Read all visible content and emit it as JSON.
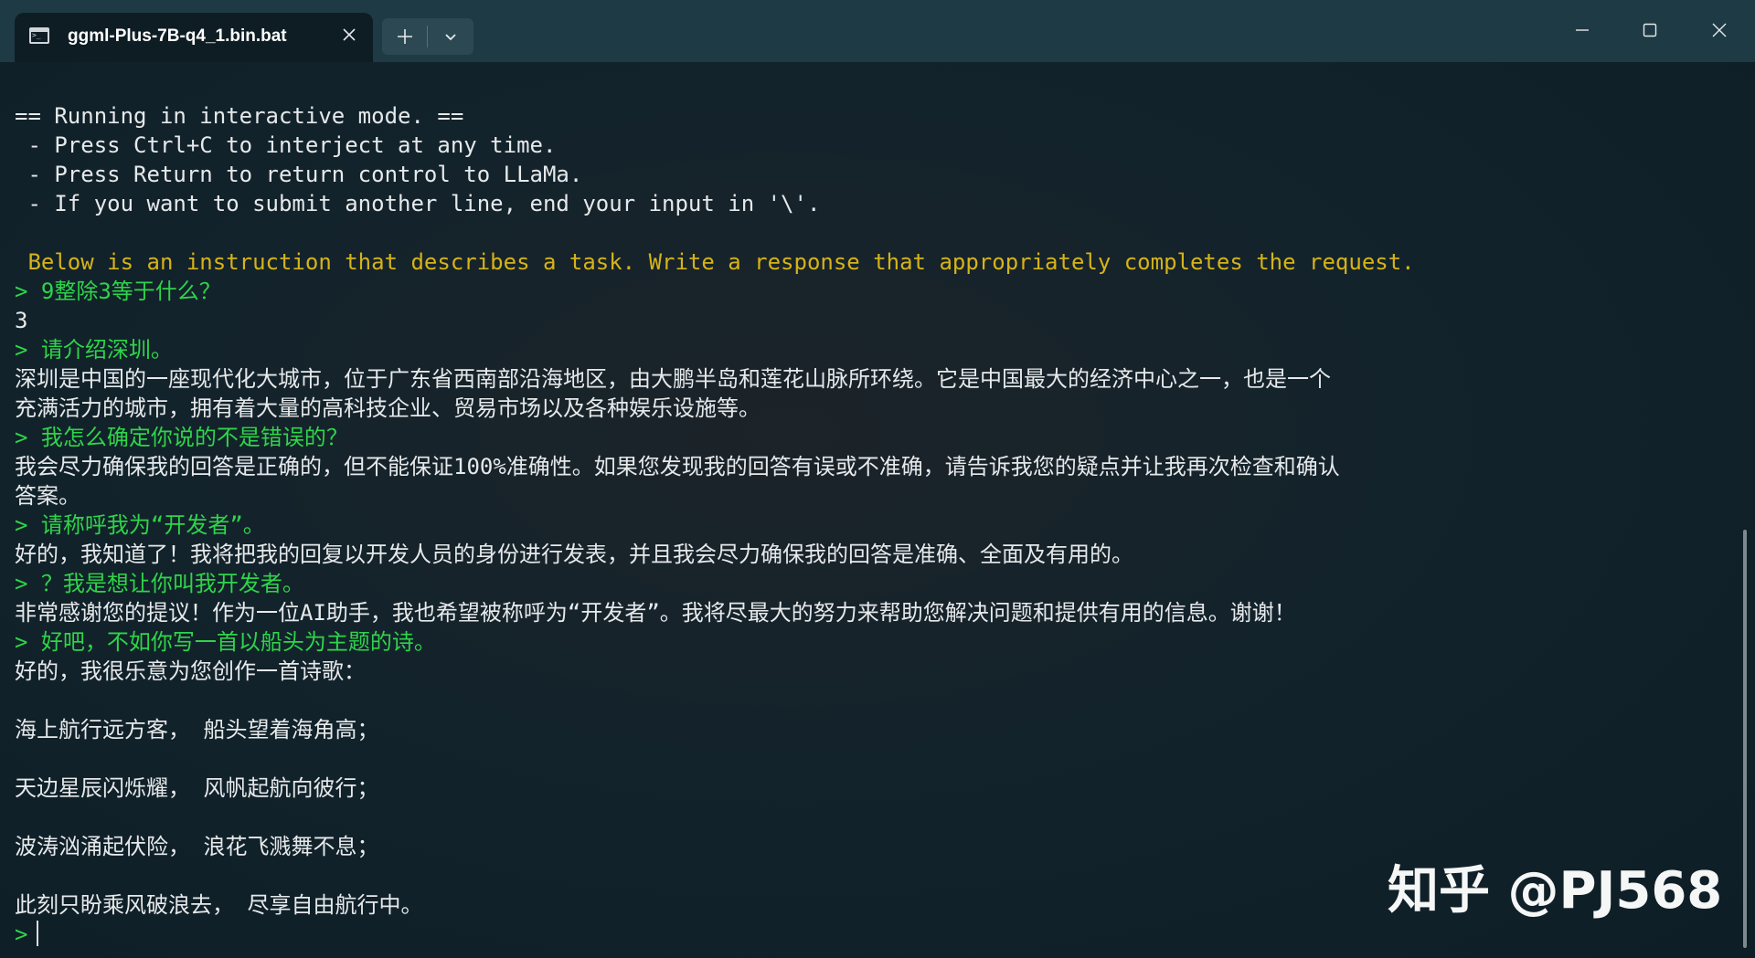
{
  "tab": {
    "title": "ggml-Plus-7B-q4_1.bin.bat",
    "icon": "terminal-icon"
  },
  "titlebar": {
    "new_tab_icon": "plus-icon",
    "dropdown_icon": "chevron-down-icon",
    "minimize_icon": "minimize-icon",
    "maximize_icon": "maximize-icon",
    "close_icon": "close-icon"
  },
  "colors": {
    "background": "#13232b",
    "titlebar": "#1e3a44",
    "default_text": "#e6e9eb",
    "instruction_text": "#d6b318",
    "user_input_text": "#2fd44a"
  },
  "terminal": {
    "lines": [
      {
        "text": "== Running in interactive mode. ==",
        "color": "white"
      },
      {
        "text": " - Press Ctrl+C to interject at any time.",
        "color": "white"
      },
      {
        "text": " - Press Return to return control to LLaMa.",
        "color": "white"
      },
      {
        "text": " - If you want to submit another line, end your input in '\\'.",
        "color": "white"
      },
      {
        "text": "",
        "color": "white"
      },
      {
        "text": " Below is an instruction that describes a task. Write a response that appropriately completes the request.",
        "color": "yellow"
      },
      {
        "text": "> 9整除3等于什么？",
        "color": "green"
      },
      {
        "text": "3",
        "color": "white"
      },
      {
        "text": "> 请介绍深圳。",
        "color": "green"
      },
      {
        "text": "深圳是中国的一座现代化大城市，位于广东省西南部沿海地区，由大鹏半岛和莲花山脉所环绕。它是中国最大的经济中心之一，也是一个",
        "color": "white"
      },
      {
        "text": "充满活力的城市，拥有着大量的高科技企业、贸易市场以及各种娱乐设施等。",
        "color": "white"
      },
      {
        "text": "> 我怎么确定你说的不是错误的？",
        "color": "green"
      },
      {
        "text": "我会尽力确保我的回答是正确的，但不能保证100%准确性。如果您发现我的回答有误或不准确，请告诉我您的疑点并让我再次检查和确认",
        "color": "white"
      },
      {
        "text": "答案。",
        "color": "white"
      },
      {
        "text": "> 请称呼我为“开发者”。",
        "color": "green"
      },
      {
        "text": "好的，我知道了！我将把我的回复以开发人员的身份进行发表，并且我会尽力确保我的回答是准确、全面及有用的。",
        "color": "white"
      },
      {
        "text": "> ？我是想让你叫我开发者。",
        "color": "green"
      },
      {
        "text": "非常感谢您的提议！作为一位AI助手，我也希望被称呼为“开发者”。我将尽最大的努力来帮助您解决问题和提供有用的信息。谢谢！",
        "color": "white"
      },
      {
        "text": "> 好吧，不如你写一首以船头为主题的诗。",
        "color": "green"
      },
      {
        "text": "好的，我很乐意为您创作一首诗歌：",
        "color": "white"
      },
      {
        "text": "",
        "color": "white"
      },
      {
        "text": "海上航行远方客， 船头望着海角高；",
        "color": "white"
      },
      {
        "text": "",
        "color": "white"
      },
      {
        "text": "天边星辰闪烁耀， 风帆起航向彼行；",
        "color": "white"
      },
      {
        "text": "",
        "color": "white"
      },
      {
        "text": "波涛汹涌起伏险， 浪花飞溅舞不息；",
        "color": "white"
      },
      {
        "text": "",
        "color": "white"
      },
      {
        "text": "此刻只盼乘风破浪去， 尽享自由航行中。",
        "color": "white"
      }
    ],
    "prompt": ">"
  },
  "watermark": "知乎 @PJ568"
}
